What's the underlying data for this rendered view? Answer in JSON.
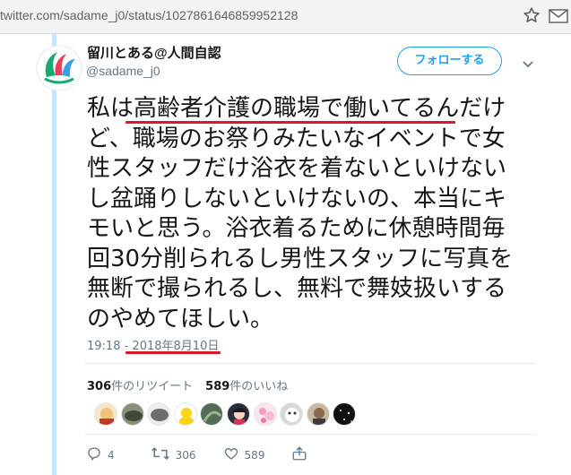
{
  "browser": {
    "url": "twitter.com/sadame_j0/status/1027861646859952128"
  },
  "tweet": {
    "display_name": "留川とある@人間自認",
    "screen_name": "@sadame_j0",
    "follow_label": "フォローする",
    "text_lines": [
      "私は高齢者介護の職場で働いてるんだけ",
      "ど、職場のお祭りみたいなイベントで女",
      "性スタッフだけ浴衣を着ないといけない",
      "し盆踊りしないといけないの、本当にキ",
      "モいと思う。浴衣着るために休憩時間毎",
      "回30分削られるし男性スタッフに写真を",
      "無断で撮られるし、無料で舞妓扱いする",
      "のやめてほしい。"
    ],
    "time": "19:18",
    "separator": " - ",
    "date": "2018年8月10日",
    "retweet_count": "306",
    "retweet_label": "件のリツイート",
    "like_count": "589",
    "like_label": "件のいいね",
    "liker_avatar_count": 9,
    "actions": {
      "reply_count": "4",
      "retweet_count": "306",
      "like_count": "589"
    }
  },
  "colors": {
    "accent": "#1da1f2",
    "highlight_underline": "#d9182c",
    "thread_line": "#c9e4f8",
    "text": "#14171a",
    "muted": "#657786"
  },
  "icons": [
    "star-icon",
    "mail-icon",
    "caret-down-icon",
    "reply-icon",
    "retweet-icon",
    "heart-icon",
    "share-icon"
  ]
}
